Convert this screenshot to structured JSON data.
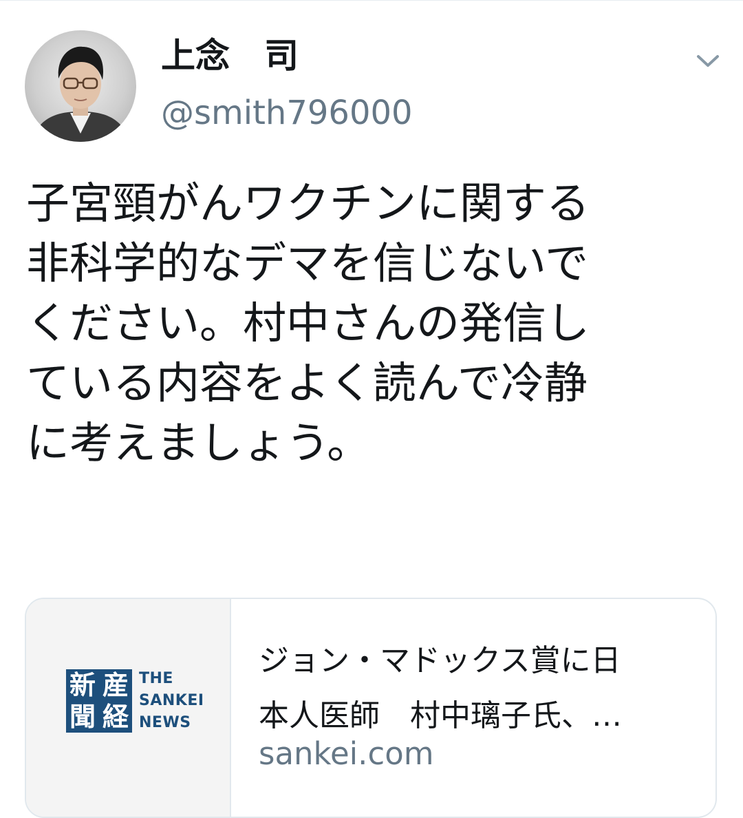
{
  "tweet": {
    "author": {
      "display_name": "上念　司",
      "handle": "@smith796000",
      "avatar_icon": "profile-photo"
    },
    "menu_icon": "chevron-down-icon",
    "text_lines": [
      "子宮頸がんワクチンに関する",
      "非科学的なデマを信じないで",
      "ください。村中さんの発信し",
      "ている内容をよく読んで冷静",
      "に考えましょう。"
    ]
  },
  "link_card": {
    "logo": {
      "kanji": [
        "新",
        "産",
        "聞",
        "経"
      ],
      "text_lines": [
        "THE",
        "SANKEI",
        "NEWS"
      ],
      "color": "#1d4f7c"
    },
    "title_lines": [
      "ジョン・マドックス賞に日",
      "本人医師　村中璃子氏、…"
    ],
    "domain": "sankei.com"
  },
  "colors": {
    "text_primary": "#14171a",
    "text_secondary": "#657786",
    "border": "#e1e8ed"
  }
}
